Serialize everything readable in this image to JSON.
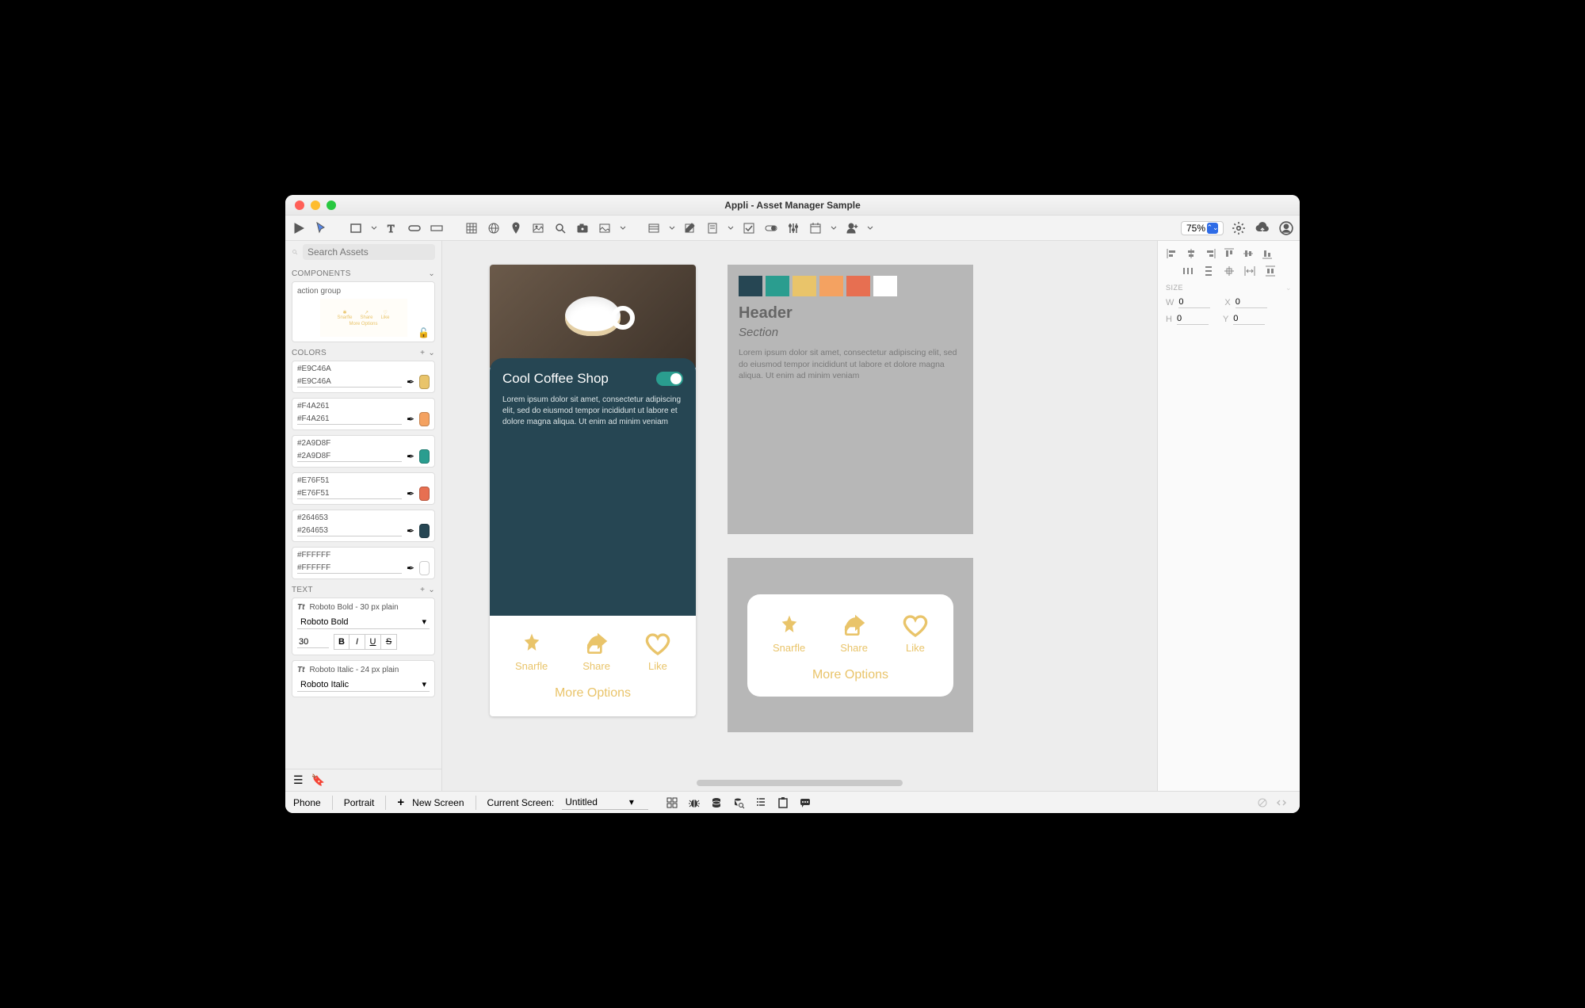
{
  "window": {
    "title": "Appli - Asset Manager Sample"
  },
  "toolbar": {
    "zoom": "75%"
  },
  "assets": {
    "search_placeholder": "Search Assets",
    "components_label": "COMPONENTS",
    "component": {
      "name": "action group",
      "more": "More Options",
      "items": [
        "Snarfle",
        "Share",
        "Like"
      ]
    },
    "colors_label": "COLORS",
    "colors": [
      {
        "hex": "#E9C46A"
      },
      {
        "hex": "#F4A261"
      },
      {
        "hex": "#2A9D8F"
      },
      {
        "hex": "#E76F51"
      },
      {
        "hex": "#264653"
      },
      {
        "hex": "#FFFFFF"
      }
    ],
    "text_label": "TEXT",
    "text_styles": [
      {
        "name": "Roboto Bold - 30 px plain",
        "font": "Roboto Bold",
        "size": "30"
      },
      {
        "name": "Roboto Italic - 24 px plain",
        "font": "Roboto Italic",
        "size": "24"
      }
    ]
  },
  "canvas": {
    "screen1": {
      "title": "Cool Coffee Shop",
      "body": "Lorem ipsum dolor sit amet, consectetur adipiscing elit, sed do eiusmod  tempor incididunt ut labore et dolore magna aliqua. Ut enim ad minim  veniam",
      "actions": {
        "a": "Snarfle",
        "b": "Share",
        "c": "Like",
        "more": "More Options"
      }
    },
    "artboard1": {
      "header": "Header",
      "section": "Section",
      "body": "Lorem ipsum dolor sit amet, consectetur adipiscing elit, sed do eiusmod  tempor incididunt ut labore et dolore magna aliqua. Ut enim ad minim  veniam",
      "palette": [
        "#264653",
        "#2A9D8F",
        "#E9C46A",
        "#F4A261",
        "#E76F51",
        "#FFFFFF"
      ]
    },
    "artboard2": {
      "actions": {
        "a": "Snarfle",
        "b": "Share",
        "c": "Like",
        "more": "More Options"
      }
    }
  },
  "props": {
    "size_label": "SIZE",
    "w_label": "W",
    "w": "0",
    "x_label": "X",
    "x": "0",
    "h_label": "H",
    "h": "0",
    "y_label": "Y",
    "y": "0"
  },
  "bottom": {
    "device": "Phone",
    "orientation": "Portrait",
    "new_screen": "New Screen",
    "current_label": "Current Screen:",
    "current": "Untitled"
  }
}
